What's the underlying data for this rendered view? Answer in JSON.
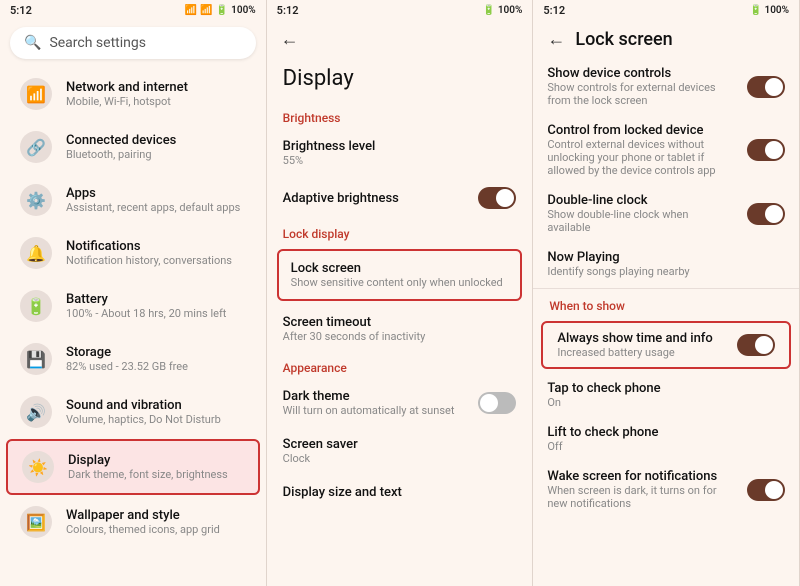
{
  "statusBar": {
    "time": "5:12",
    "icons": "🔵 📶 🔋 100%"
  },
  "panel1": {
    "search": {
      "placeholder": "Search settings"
    },
    "items": [
      {
        "id": "network",
        "icon": "📶",
        "title": "Network and internet",
        "sub": "Mobile, Wi-Fi, hotspot"
      },
      {
        "id": "connected",
        "icon": "🔗",
        "title": "Connected devices",
        "sub": "Bluetooth, pairing"
      },
      {
        "id": "apps",
        "icon": "⚙️",
        "title": "Apps",
        "sub": "Assistant, recent apps, default apps"
      },
      {
        "id": "notifications",
        "icon": "🔔",
        "title": "Notifications",
        "sub": "Notification history, conversations"
      },
      {
        "id": "battery",
        "icon": "🔋",
        "title": "Battery",
        "sub": "100% - About 18 hrs, 20 mins left"
      },
      {
        "id": "storage",
        "icon": "💾",
        "title": "Storage",
        "sub": "82% used - 23.52 GB free"
      },
      {
        "id": "sound",
        "icon": "🔊",
        "title": "Sound and vibration",
        "sub": "Volume, haptics, Do Not Disturb"
      },
      {
        "id": "display",
        "icon": "☀️",
        "title": "Display",
        "sub": "Dark theme, font size, brightness",
        "active": true
      },
      {
        "id": "wallpaper",
        "icon": "🖼️",
        "title": "Wallpaper and style",
        "sub": "Colours, themed icons, app grid"
      }
    ]
  },
  "panel2": {
    "back": "←",
    "title": "Display",
    "sections": [
      {
        "label": "Brightness",
        "items": [
          {
            "id": "brightness",
            "title": "Brightness level",
            "sub": "55%",
            "hasToggle": false
          },
          {
            "id": "adaptive",
            "title": "Adaptive brightness",
            "sub": "",
            "hasToggle": true,
            "toggleOn": true
          }
        ]
      },
      {
        "label": "Lock display",
        "items": [
          {
            "id": "lockscreen",
            "title": "Lock screen",
            "sub": "Show sensitive content only when unlocked",
            "hasToggle": false,
            "highlighted": true
          },
          {
            "id": "screentimeout",
            "title": "Screen timeout",
            "sub": "After 30 seconds of inactivity",
            "hasToggle": false
          }
        ]
      },
      {
        "label": "Appearance",
        "items": [
          {
            "id": "darktheme",
            "title": "Dark theme",
            "sub": "Will turn on automatically at sunset",
            "hasToggle": true,
            "toggleOn": false
          },
          {
            "id": "screensaver",
            "title": "Screen saver",
            "sub": "Clock",
            "hasToggle": false
          }
        ]
      },
      {
        "label": "",
        "items": [
          {
            "id": "displaysize",
            "title": "Display size and text",
            "sub": "",
            "hasToggle": false
          }
        ]
      }
    ]
  },
  "panel3": {
    "back": "←",
    "title": "Lock screen",
    "items": [
      {
        "id": "devicecontrols",
        "title": "Show device controls",
        "sub": "Show controls for external devices from the lock screen",
        "hasToggle": true,
        "toggleOn": true
      },
      {
        "id": "controlfromlocked",
        "title": "Control from locked device",
        "sub": "Control external devices without unlocking your phone or tablet if allowed by the device controls app",
        "hasToggle": true,
        "toggleOn": true
      },
      {
        "id": "doubleclock",
        "title": "Double-line clock",
        "sub": "Show double-line clock when available",
        "hasToggle": true,
        "toggleOn": true
      },
      {
        "id": "nowplaying",
        "title": "Now Playing",
        "sub": "Identify songs playing nearby",
        "hasToggle": false
      }
    ],
    "whenToShow": {
      "label": "When to show",
      "items": [
        {
          "id": "alwaysshow",
          "title": "Always show time and info",
          "sub": "Increased battery usage",
          "hasToggle": true,
          "toggleOn": true,
          "highlighted": true
        },
        {
          "id": "tapcheck",
          "title": "Tap to check phone",
          "sub": "On",
          "hasToggle": false
        },
        {
          "id": "liftcheck",
          "title": "Lift to check phone",
          "sub": "Off",
          "hasToggle": false
        },
        {
          "id": "wakenotif",
          "title": "Wake screen for notifications",
          "sub": "When screen is dark, it turns on for new notifications",
          "hasToggle": true,
          "toggleOn": true
        }
      ]
    }
  }
}
